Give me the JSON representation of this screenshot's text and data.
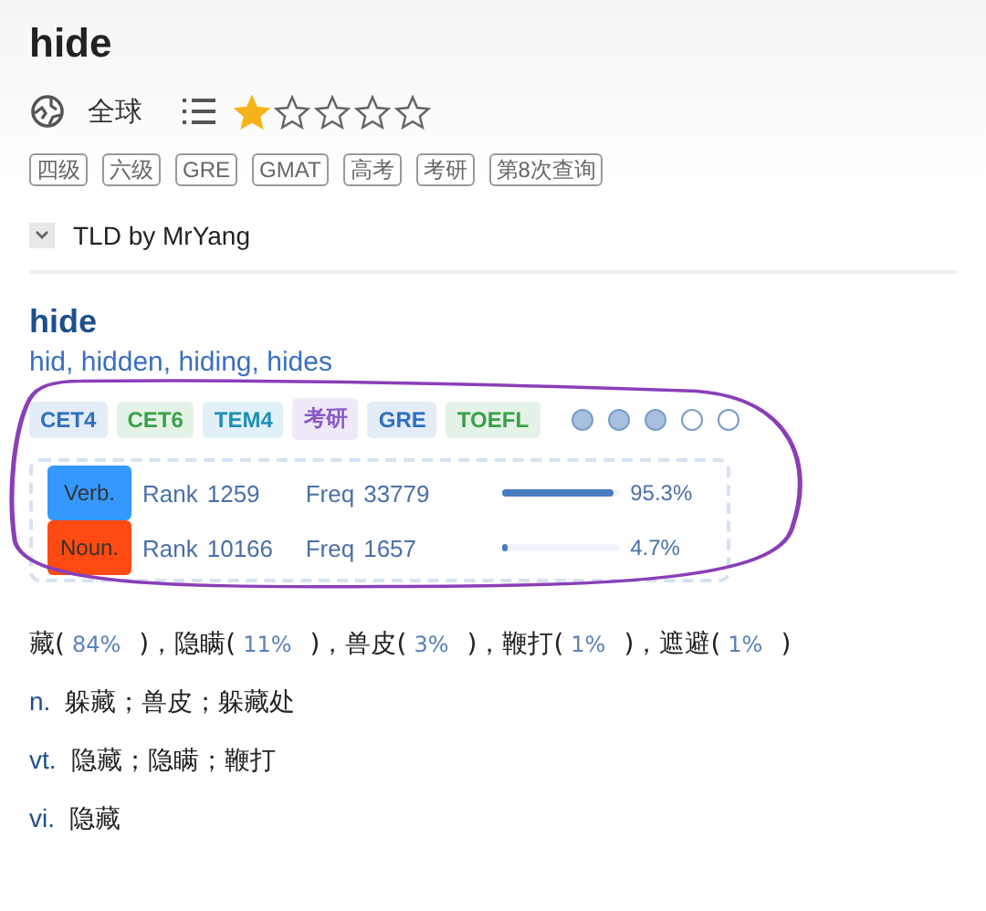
{
  "title": "hide",
  "meta": {
    "region": "全球",
    "stars": 1
  },
  "tags": [
    "四级",
    "六级",
    "GRE",
    "GMAT",
    "高考",
    "考研",
    "第8次查询"
  ],
  "dictionary": {
    "name": "TLD by MrYang",
    "expanded": true
  },
  "entry": {
    "word": "hide",
    "forms": "hid, hidden, hiding, hides",
    "exam_tags": [
      {
        "label": "CET4",
        "color": "#2f6fc0"
      },
      {
        "label": "CET6",
        "color": "#3aa048"
      },
      {
        "label": "TEM4",
        "color": "#1d8fb8"
      },
      {
        "label": "考研",
        "color": "#8a5cc8"
      },
      {
        "label": "GRE",
        "color": "#2f6fc0"
      },
      {
        "label": "TOEFL",
        "color": "#3aa048"
      }
    ],
    "difficulty": [
      {
        "filled": true
      },
      {
        "filled": true
      },
      {
        "filled": true
      },
      {
        "filled": false
      },
      {
        "filled": false
      }
    ],
    "frequency": [
      {
        "pos": "Verb.",
        "color": "#3399ff",
        "rank_label": "Rank",
        "rank": "1259",
        "freq_label": "Freq",
        "freq": "33779",
        "level": 0.953,
        "percent": "95.3%"
      },
      {
        "pos": "Noun.",
        "color": "#ff4a12",
        "rank_label": "Rank",
        "rank": "10166",
        "freq_label": "Freq",
        "freq": "1657",
        "level": 0.047,
        "percent": "4.7%"
      }
    ],
    "translations": [
      {
        "word": "藏(",
        "percent": "84%",
        "close": ")，"
      },
      {
        "word": "隐瞒(",
        "percent": "11%",
        "close": ")，"
      },
      {
        "word": "兽皮(",
        "percent": "3%",
        "close": ")，"
      },
      {
        "word": "鞭打(",
        "percent": "1%",
        "close": ")，"
      },
      {
        "word": "遮避(",
        "percent": "1%",
        "close": ")"
      }
    ],
    "definitions": [
      {
        "pos": "n.",
        "text": "躲藏；兽皮；躲藏处"
      },
      {
        "pos": "vt.",
        "text": "隐藏；隐瞒；鞭打"
      },
      {
        "pos": "vi.",
        "text": "隐藏"
      }
    ]
  }
}
